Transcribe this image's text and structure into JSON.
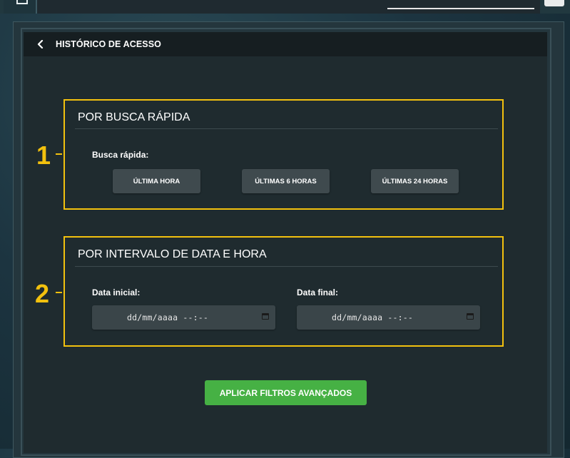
{
  "header": {
    "title": "HISTÓRICO DE ACESSO",
    "back_icon": "chevron-left-icon"
  },
  "quick_search": {
    "marker": "1",
    "title": "POR BUSCA RÁPIDA",
    "label": "Busca rápida:",
    "buttons": [
      "ÚLTIMA HORA",
      "ÚLTIMAS 6 HORAS",
      "ÚLTIMAS 24 HORAS"
    ]
  },
  "date_range": {
    "marker": "2",
    "title": "POR INTERVALO DE DATA E HORA",
    "start_label": "Data inicial:",
    "end_label": "Data final:",
    "start_placeholder": "dd/mm/aaaa --:--",
    "end_placeholder": "dd/mm/aaaa --:--",
    "calendar_icon": "calendar-icon"
  },
  "apply_button": "APLICAR FILTROS AVANÇADOS",
  "colors": {
    "highlight": "#f2c10e",
    "apply": "#46b144",
    "panel": "#1f2b2f"
  }
}
